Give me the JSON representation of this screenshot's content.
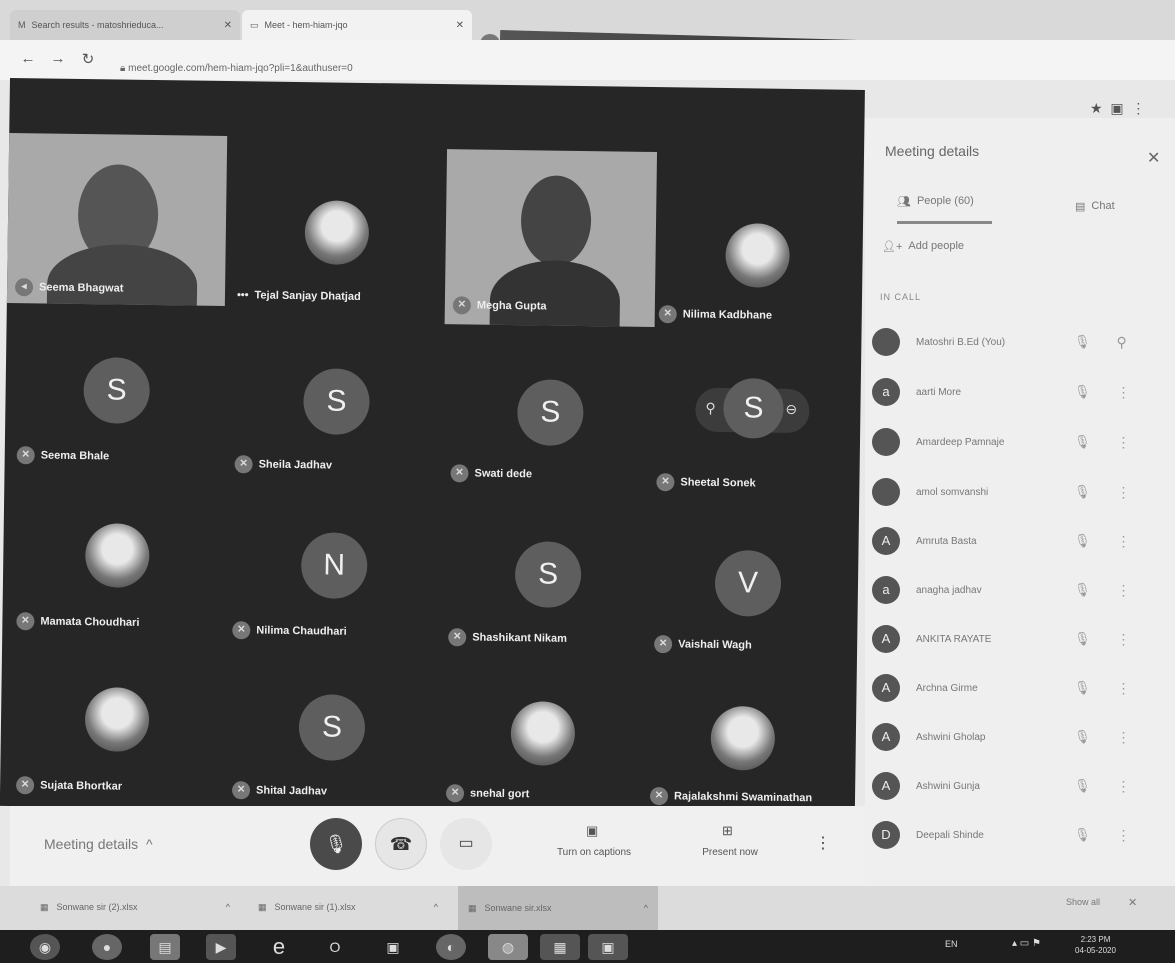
{
  "browser": {
    "tabs": [
      {
        "label": "Search results - matoshrieduca..."
      },
      {
        "label": "Meet - hem-hiam-jqo"
      }
    ],
    "url": "meet.google.com/hem-hiam-jqo?pli=1&authuser=0"
  },
  "tiles": [
    {
      "name": "Seema Bhagwat"
    },
    {
      "name": "Tejal Sanjay Dhatjad"
    },
    {
      "name": "Megha Gupta"
    },
    {
      "name": "Nilima Kadbhane"
    },
    {
      "name": "Seema Bhale",
      "initial": "S"
    },
    {
      "name": "Sheila Jadhav",
      "initial": "S"
    },
    {
      "name": "Swati dede",
      "initial": "S"
    },
    {
      "name": "Sheetal Sonek",
      "initial": "S"
    },
    {
      "name": "Mamata Choudhari"
    },
    {
      "name": "Nilima Chaudhari",
      "initial": "N"
    },
    {
      "name": "Shashikant Nikam",
      "initial": "S"
    },
    {
      "name": "Vaishali Wagh",
      "initial": "V"
    },
    {
      "name": "Sujata Bhortkar"
    },
    {
      "name": "Shital Jadhav",
      "initial": "S"
    },
    {
      "name": "snehal gort"
    },
    {
      "name": "Rajalakshmi Swaminathan"
    }
  ],
  "panel": {
    "title": "Meeting details",
    "people_tab": "People (60)",
    "chat_tab": "Chat",
    "add_people": "Add people",
    "in_call": "IN CALL",
    "people": [
      {
        "name": "Matoshri B.Ed (You)",
        "initial": ""
      },
      {
        "name": "aarti More",
        "initial": "a"
      },
      {
        "name": "Amardeep Pamnaje",
        "initial": ""
      },
      {
        "name": "amol somvanshi",
        "initial": ""
      },
      {
        "name": "Amruta Basta",
        "initial": "A"
      },
      {
        "name": "anagha jadhav",
        "initial": "a"
      },
      {
        "name": "ANKITA RAYATE",
        "initial": "A"
      },
      {
        "name": "Archna Girme",
        "initial": "A"
      },
      {
        "name": "Ashwini Gholap",
        "initial": "A"
      },
      {
        "name": "Ashwini Gunja",
        "initial": "A"
      },
      {
        "name": "Deepali Shinde",
        "initial": "D"
      }
    ]
  },
  "controls": {
    "meeting_details": "Meeting details",
    "captions": "Turn on captions",
    "present": "Present now"
  },
  "downloads": [
    {
      "label": "Sonwane sir (2).xlsx"
    },
    {
      "label": "Sonwane sir (1).xlsx"
    },
    {
      "label": "Sonwane sir.xlsx"
    }
  ],
  "show_all": "Show all",
  "taskbar": {
    "lang": "EN",
    "time": "2:23 PM",
    "date": "04-05-2020"
  }
}
